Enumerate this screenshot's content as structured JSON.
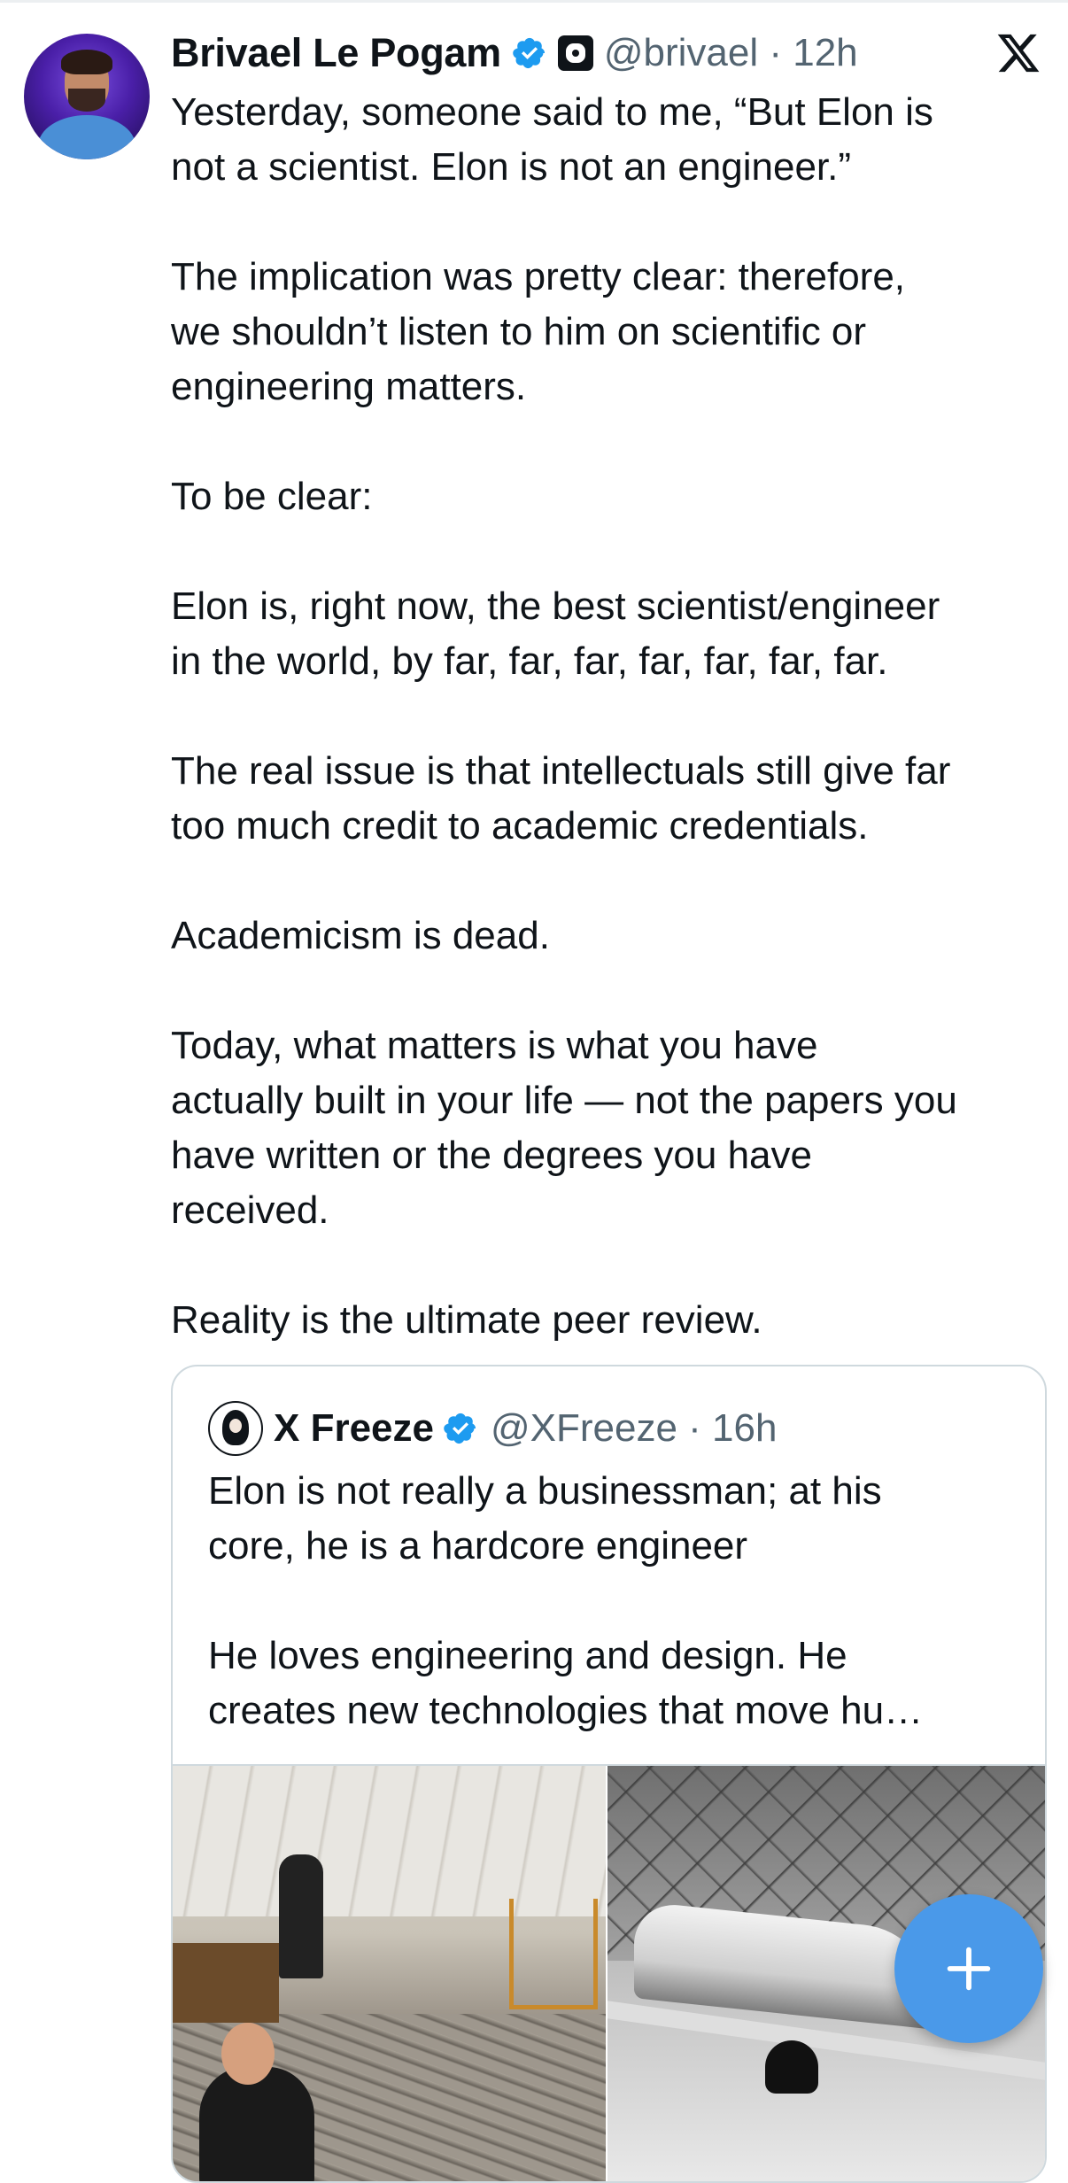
{
  "post": {
    "author_name": "Brivael Le Pogam",
    "handle_time": "@brivael · 12h",
    "avatar_icon": "user-avatar",
    "verified_icon": "verified-badge-icon",
    "affiliation_icon": "affiliate-logo-icon",
    "text": "Yesterday, someone said to me, “But Elon is\nnot a scientist. Elon is not an engineer.”\n\nThe implication was pretty clear: therefore,\nwe shouldn’t listen to him on scientific or\nengineering matters.\n\nTo be clear:\n\nElon is, right now, the best scientist/engineer\nin the world, by far, far, far, far, far, far, far.\n\nThe real issue is that intellectuals still give far\ntoo much credit to academic credentials.\n\nAcademicism is dead.\n\nToday, what matters is what you have\nactually built in your life — not the papers you\nhave written or the degrees you have\nreceived.\n\nReality is the ultimate peer review."
  },
  "quoted_post": {
    "author_name": "X Freeze",
    "handle_time": "@XFreeze · 16h",
    "text": "Elon is not really a businessman; at his\ncore, he is a hardcore engineer\n\nHe loves engineering and design. He\ncreates new technologies that move hu…",
    "media": [
      "workshop-photo",
      "factory-photo"
    ]
  },
  "app": {
    "logo_icon": "x-logo-icon",
    "compose_icon": "plus-icon"
  },
  "colors": {
    "accent": "#1d9bf0",
    "fab": "#4a99e9",
    "secondary_text": "#536471",
    "border": "#cfd9de"
  }
}
